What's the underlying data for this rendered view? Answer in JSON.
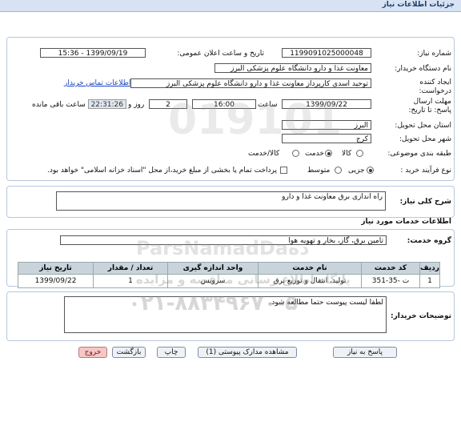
{
  "header": {
    "title": "جزئیات اطلاعات نیاز"
  },
  "form": {
    "need_number_label": "شماره نیاز:",
    "need_number": "1199091025000048",
    "announce_label": "تاریخ و ساعت اعلان عمومی:",
    "announce_value": "1399/09/19 - 15:36",
    "buyer_label": "نام دستگاه خریدار:",
    "buyer_value": "معاونت غذا و دارو دانشگاه علوم پزشکی البرز",
    "creator_label": "ایجاد کننده درخواست:",
    "creator_value": "توحید اسدی کارپرداز معاونت غذا و دارو دانشگاه علوم پزشکی البرز",
    "contact_link": "اطلاعات تماس خریدار",
    "deadline_label": "مهلت ارسال پاسخ: تا تاریخ:",
    "deadline_date": "1399/09/22",
    "hour_label": "ساعت",
    "deadline_time": "16:00",
    "days_value": "2",
    "days_label": "روز و",
    "remaining_time": "22:31:26",
    "remaining_label": "ساعت باقی مانده",
    "province_label": "استان محل تحویل:",
    "province_value": "البرز",
    "city_label": "شهر محل تحویل:",
    "city_value": "کرج",
    "category_label": "طبقه بندی موضوعی:",
    "category_options": [
      "کالا",
      "خدمت",
      "کالا/خدمت"
    ],
    "process_label": "نوع فرآیند خرید :",
    "process_options": [
      "جزیی",
      "متوسط"
    ],
    "payment_note": "پرداخت تمام یا بخشی از مبلغ خرید،از محل \"اسناد خزانه اسلامی\" خواهد بود."
  },
  "description": {
    "label": "شرح کلی نیاز:",
    "value": "راه اندازی برق معاونت غذا و دارو"
  },
  "services": {
    "section_title": "اطلاعات خدمات مورد نیاز",
    "group_label": "گروه خدمت:",
    "group_value": "تامین برق، گاز، بخار و تهویه هوا",
    "table": {
      "headers": [
        "ردیف",
        "کد خدمت",
        "نام خدمت",
        "واحد اندازه گیری",
        "تعداد / مقدار",
        "تاریخ نیاز"
      ],
      "rows": [
        [
          "1",
          "ت -35-351",
          "تولید، انتقال و توزیع برق",
          "سرویس",
          "1",
          "1399/09/22"
        ]
      ]
    }
  },
  "buyer_notes": {
    "label": "توضیحات خریدار:",
    "value": "لطفا لیست پیوست حتما مطالعه شود."
  },
  "buttons": {
    "reply": "پاسخ به نیاز",
    "attachments": "مشاهده مدارک پیوستی (1)",
    "print": "چاپ",
    "back": "بازگشت",
    "exit": "خروج"
  },
  "watermark": {
    "brand": "ParsNamadDaده",
    "subtitle": "پایگاه اطلاع رسانی مناقصه و مزایده",
    "phone": "۰۲۱-۸۸۳۴۹۶۷۰-۵",
    "number": "019101"
  },
  "colors": {
    "title_bar": "#d7e3f3",
    "panel_border": "#b7c7dc",
    "link": "#1a44c4",
    "table_header": "#c9d3dc",
    "exit_button": "#f6c7c7"
  }
}
